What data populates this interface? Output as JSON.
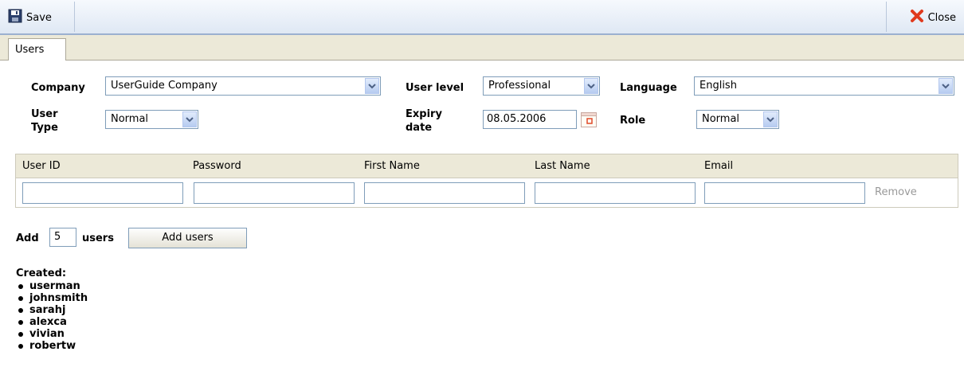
{
  "toolbar": {
    "save_label": "Save",
    "close_label": "Close"
  },
  "tabs": [
    {
      "label": "Users"
    }
  ],
  "form": {
    "company_label": "Company",
    "company_value": "UserGuide Company",
    "user_level_label": "User level",
    "user_level_value": "Professional",
    "language_label": "Language",
    "language_value": "English",
    "user_type_label_line1": "User",
    "user_type_label_line2": "Type",
    "user_type_value": "Normal",
    "expiry_label_line1": "Expiry",
    "expiry_label_line2": "date",
    "expiry_value": "08.05.2006",
    "role_label": "Role",
    "role_value": "Normal"
  },
  "grid": {
    "columns": [
      "User ID",
      "Password",
      "First Name",
      "Last Name",
      "Email"
    ],
    "rows": [
      {
        "user_id": "",
        "password": "",
        "first_name": "",
        "last_name": "",
        "email": "",
        "remove_label": "Remove"
      }
    ]
  },
  "add_users": {
    "prefix": "Add",
    "count": "5",
    "suffix": "users",
    "button_label": "Add users"
  },
  "created": {
    "title": "Created:",
    "items": [
      "userman",
      "johnsmith",
      "sarahj",
      "alexca",
      "vivian",
      "robertw"
    ]
  },
  "colors": {
    "toolbar_border": "#9bb0d0",
    "panel_bg": "#ece9d8",
    "input_border": "#7f9db9",
    "close_icon": "#e03a1e"
  }
}
